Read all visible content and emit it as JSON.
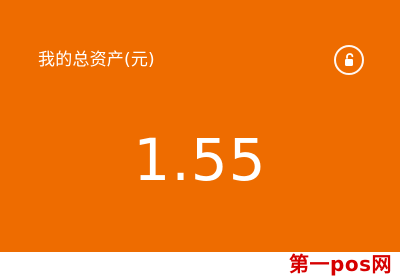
{
  "asset_card": {
    "title": "我的总资产(元)",
    "value": "1.55",
    "icon": "unlock-icon",
    "background_color": "#ee6c00",
    "text_color": "#ffffff"
  },
  "watermark": {
    "text": "第一pos网",
    "color": "#d60000"
  }
}
